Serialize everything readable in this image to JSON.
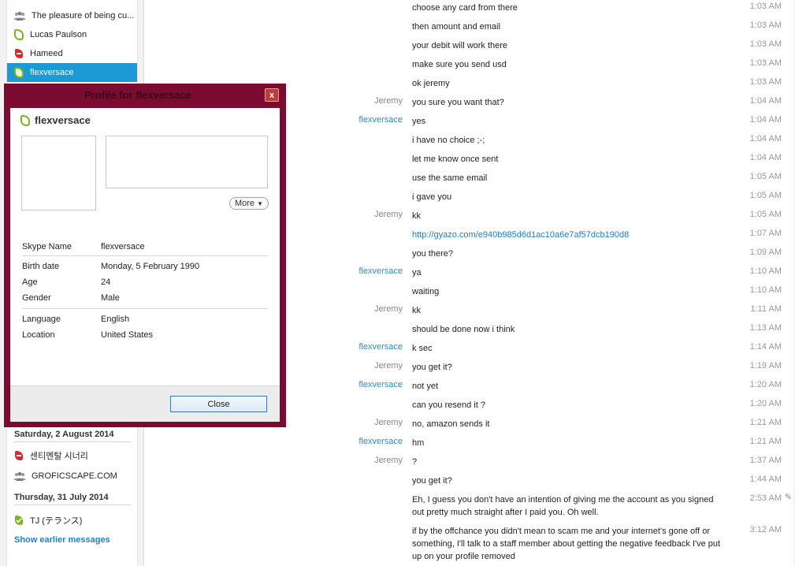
{
  "sidebar": {
    "recent_top": [
      {
        "label": "The pleasure of being cu...",
        "icon": "group-icon"
      },
      {
        "label": "Lucas Paulson",
        "icon": "status-online-icon"
      },
      {
        "label": "Hameed",
        "icon": "status-dnd-icon"
      },
      {
        "label": "flexversace",
        "icon": "status-online-icon",
        "selected": true
      }
    ],
    "date_1": "Saturday, 2 August 2014",
    "recent_mid": [
      {
        "label": "센티멘탈 시너리",
        "icon": "status-dnd-icon"
      },
      {
        "label": "GROFICSCAPE.COM",
        "icon": "group-icon"
      }
    ],
    "date_2": "Thursday, 31 July 2014",
    "recent_bottom": [
      {
        "label": "TJ (テランス)",
        "icon": "status-online-check-icon"
      }
    ],
    "show_earlier": "Show earlier messages"
  },
  "profile": {
    "title": "Profile for flexversace",
    "close_x": "x",
    "name": "flexversace",
    "more_label": "More",
    "fields": {
      "skype_name": {
        "key": "Skype Name",
        "value": "flexversace"
      },
      "birth_date": {
        "key": "Birth date",
        "value": "Monday, 5 February 1990"
      },
      "age": {
        "key": "Age",
        "value": "24"
      },
      "gender": {
        "key": "Gender",
        "value": "Male"
      },
      "language": {
        "key": "Language",
        "value": "English"
      },
      "location": {
        "key": "Location",
        "value": "United States"
      }
    },
    "close_button": "Close"
  },
  "chat": {
    "messages": [
      {
        "sender": "",
        "text": "choose any card from there",
        "time": "1:03 AM"
      },
      {
        "sender": "",
        "text": "then amount and email",
        "time": "1:03 AM"
      },
      {
        "sender": "",
        "text": "your debit will work there",
        "time": "1:03 AM"
      },
      {
        "sender": "",
        "text": "make sure you send usd",
        "time": "1:03 AM"
      },
      {
        "sender": "",
        "text": "ok jeremy",
        "time": "1:03 AM"
      },
      {
        "sender": "Jeremy",
        "text": "you sure you want that?",
        "time": "1:04 AM"
      },
      {
        "sender": "flexversace",
        "text": "yes",
        "time": "1:04 AM",
        "you": true
      },
      {
        "sender": "",
        "text": "i have no choice ;-;",
        "time": "1:04 AM"
      },
      {
        "sender": "",
        "text": "let me know once sent",
        "time": "1:04 AM"
      },
      {
        "sender": "",
        "text": "use the same email",
        "time": "1:05 AM"
      },
      {
        "sender": "",
        "text": "i gave you",
        "time": "1:05 AM"
      },
      {
        "sender": "Jeremy",
        "text": "kk",
        "time": "1:05 AM"
      },
      {
        "sender": "",
        "text": "http://gyazo.com/e940b985d6d1ac10a6e7af57dcb190d8",
        "time": "1:07 AM",
        "link": true
      },
      {
        "sender": "",
        "text": "you there?",
        "time": "1:09 AM"
      },
      {
        "sender": "flexversace",
        "text": "ya",
        "time": "1:10 AM",
        "you": true
      },
      {
        "sender": "",
        "text": "waiting",
        "time": "1:10 AM"
      },
      {
        "sender": "Jeremy",
        "text": "kk",
        "time": "1:11 AM"
      },
      {
        "sender": "",
        "text": "should be done now i think",
        "time": "1:13 AM"
      },
      {
        "sender": "flexversace",
        "text": "k sec",
        "time": "1:14 AM",
        "you": true
      },
      {
        "sender": "Jeremy",
        "text": "you get it?",
        "time": "1:19 AM"
      },
      {
        "sender": "flexversace",
        "text": "not yet",
        "time": "1:20 AM",
        "you": true
      },
      {
        "sender": "",
        "text": "can you resend it ?",
        "time": "1:20 AM"
      },
      {
        "sender": "Jeremy",
        "text": "no, amazon sends it",
        "time": "1:21 AM"
      },
      {
        "sender": "flexversace",
        "text": "hm",
        "time": "1:21 AM",
        "you": true
      },
      {
        "sender": "Jeremy",
        "text": "?",
        "time": "1:37 AM"
      },
      {
        "sender": "",
        "text": "you get it?",
        "time": "1:44 AM"
      },
      {
        "sender": "",
        "text": "Eh, I guess you don't have an intention of giving me the account as you signed out pretty much straight after I paid you. Oh well.",
        "time": "2:53 AM",
        "edited": true
      },
      {
        "sender": "",
        "text": "if by the offchance you didn't mean to scam me and your internet's gone off or something, I'll talk to a staff member about getting the negative feedback I've put up on your profile removed",
        "time": "3:12 AM"
      }
    ]
  },
  "colors": {
    "accent": "#1c9ad6",
    "dialog_frame": "#7b0b30",
    "link": "#1c7fc7",
    "online": "#7ab51d",
    "dnd": "#d52b2b"
  }
}
